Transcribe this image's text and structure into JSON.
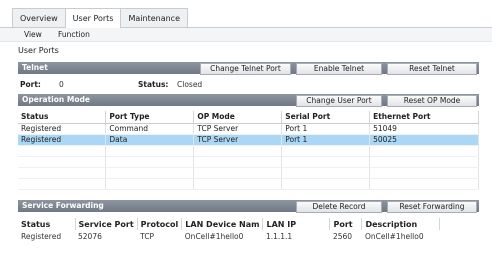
{
  "tabs": [
    "Overview",
    "User Ports",
    "Maintenance"
  ],
  "subnav": [
    "View",
    "Function"
  ],
  "page_title": "User Ports",
  "telnet": {
    "title": "Telnet",
    "buttons": [
      "Change Telnet Port",
      "Enable Telnet",
      "Reset Telnet"
    ],
    "port_label": "Port:",
    "port_value": "0",
    "status_label": "Status:",
    "status_value": "Closed"
  },
  "operation_mode": {
    "title": "Operation Mode",
    "buttons": [
      "Change User Port",
      "Reset OP Mode"
    ],
    "columns": [
      "Status",
      "Port Type",
      "OP Mode",
      "Serial Port",
      "Ethernet Port"
    ],
    "rows": [
      [
        "Registered",
        "Command",
        "TCP Server",
        "Port 1",
        "51049"
      ],
      [
        "Registered",
        "Data",
        "TCP Server",
        "Port 1",
        "50025"
      ],
      [
        "",
        "",
        "",
        "",
        ""
      ],
      [
        "",
        "",
        "",
        "",
        ""
      ],
      [
        "",
        "",
        "",
        "",
        ""
      ],
      [
        "",
        "",
        "",
        "",
        ""
      ]
    ]
  },
  "service_forwarding": {
    "title": "Service Forwarding",
    "buttons": [
      "Delete Record",
      "Reset Forwarding"
    ],
    "columns": [
      "Status",
      "Service Port",
      "Protocol",
      "LAN Device Nam",
      "LAN IP",
      "Port",
      "Description"
    ],
    "rows": [
      [
        "Registered",
        "52076",
        "TCP",
        "OnCell#1hello0",
        "1.1.1.1",
        "2560",
        "OnCell#1hello0"
      ]
    ]
  }
}
